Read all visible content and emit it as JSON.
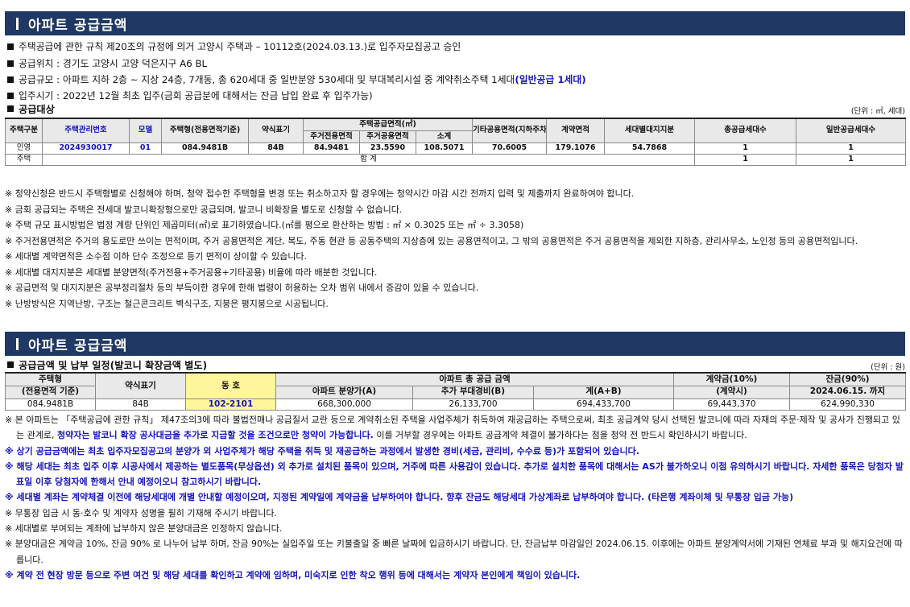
{
  "section1": {
    "title": "아파트 공급금액",
    "info": [
      "주택공급에 관한 규칙 제20조의 규정에 의거 고양시 주택과 – 10112호(2024.03.13.)로  입주자모집공고 승인",
      "공급위치 : 경기도 고양시 고양 덕은지구 A6 BL",
      "입주시기 : 2022년 12월 최초 입주(금회 공급분에 대해서는 잔금 납입 완료 후 입주가능)"
    ],
    "scale_pre": "공급규모 : 아파트 지하 2층 ~ 지상 24층, 7개동, 총 620세대 중 일반분양 530세대 및 부대복리시설 중 계약취소주택 1세대",
    "scale_blue": "(일반공급 1세대)",
    "subtitle": "공급대상",
    "unit": "(단위 : ㎡, 세대)",
    "table": {
      "h_type": "주택구분",
      "h_code": "주택관리번호",
      "h_model": "모델",
      "h_housetype": "주택형(전용면적기준)",
      "h_abbr": "약식표기",
      "h_supply_area": "주택공급면적(㎡)",
      "h_exclusive": "주거전용면적",
      "h_common": "주거공용면적",
      "h_subtotal": "소계",
      "h_other": "기타공용면적(지하주차장등)",
      "h_contract_area": "계약면적",
      "h_land": "세대별대지지분",
      "h_total_units": "총공급세대수",
      "h_general_units": "일반공급세대수",
      "row": {
        "type": "민영",
        "code": "2024930017",
        "model": "01",
        "housetype": "084.9481B",
        "abbr": "84B",
        "exclusive": "84.9481",
        "common": "23.5590",
        "subtotal": "108.5071",
        "other": "70.6005",
        "contract": "179.1076",
        "land": "54.7868",
        "total": "1",
        "general": "1"
      },
      "total_row": {
        "type": "주택",
        "label": "합 계",
        "total": "1",
        "general": "1"
      }
    },
    "notes": [
      "※ 청약신청은 반드시 주택형별로 신청해야 하며, 청약 접수한 주택형을 변경 또는 취소하고자 할 경우에는 청약시간 마감 시간 전까지 입력 및 제출까지 완료하여야 합니다.",
      "※ 금회 공급되는 주택은 전세대 발코니확장형으로만 공급되며, 발코니 비확장을 별도로 신청할 수 없습니다.",
      "※ 주택 규모 표시방법은 법정 계량 단위인 제곱미터(㎡)로 표기하였습니다.(㎡를 평으로 환산하는 방법 : ㎡ × 0.3025 또는 ㎡ ÷ 3.3058)",
      "※ 주거전용면적은 주거의 용도로만 쓰이는 면적이며, 주거 공용면적은 계단, 복도, 주동 현관 등 공동주택의 지상층에 있는 공용면적이고, 그 밖의 공용면적은 주거 공용면적을 제외한 지하층, 관리사무소, 노인정 등의 공용면적입니다.",
      "※ 세대별 계약면적은 소수점 이하 단수 조정으로 등기 면적이 상이할 수 있습니다.",
      "※ 세대별 대지지분은 세대별 분양면적(주거전용+주거공용+기타공용) 비율에 따라 배분한 것입니다.",
      "※ 공급면적 및 대지지분은 공부정리절차 등의 부득이한 경우에 한해 법령이 허용하는 오차 범위 내에서 증감이 있을 수 있습니다.",
      "※ 난방방식은 지역난방, 구조는 철근콘크리트 벽식구조, 지붕은 평지붕으로 시공됩니다."
    ]
  },
  "section2": {
    "title": "아파트 공급금액",
    "subtitle": "공급금액 및 납부 일정(발코니 확장금액 별도)",
    "unit": "(단위 : 원)",
    "table": {
      "h_housetype": "주택형",
      "h_housetype_sub": "(전용면적 기준)",
      "h_abbr": "약식표기",
      "h_unit": "동 호",
      "h_total": "아파트 총 공급 금액",
      "h_price": "아파트 분양가(A)",
      "h_extra": "추가 부대경비(B)",
      "h_sum": "계(A+B)",
      "h_deposit": "계약금(10%)",
      "h_deposit_sub": "(계약시)",
      "h_balance": "잔금(90%)",
      "h_balance_sub": "2024.06.15. 까지",
      "row": {
        "housetype": "084.9481B",
        "abbr": "84B",
        "unit": "102-2101",
        "price": "668,300,000",
        "extra": "26,133,700",
        "sum": "694,433,700",
        "deposit": "69,443,370",
        "balance": "624,990,330"
      }
    },
    "note1_pre": "※ 본 아파트는 「주택공급에 관한 규칙」 제47조의3에 따라 불법전매나 공급질서 교란 등으로 계약취소된 주택을 사업주체가 취득하여 재공급하는 주택으로써, 최초 공급계약 당시 선택된 발코니에 따라 자재의 주문·제작 및 공사가 진행되고 있는 관계로, ",
    "note1_blue": "청약자는 발코니 확장 공사대금을 추가로 지급할 것을 조건으로만 청약이 가능합니다.",
    "note1_post": " 이를 거부할 경우에는 아파트 공급계약 체결이 불가하다는 점을 청약 전 반드시 확인하시기 바랍니다.",
    "notes_blue": [
      "※ 상기 공급금액에는 최초 입주자모집공고의 분양가 외 사업주체가 해당 주택을 취득 및 재공급하는 과정에서 발생한 경비(세금, 관리비, 수수료 등)가 포함되어 있습니다.",
      "※ 해당 세대는 최초 입주 이후 시공사에서 제공하는 별도품목(무상옵션) 외 추가로 설치된 품목이 있으며, 거주에 따른 사용감이 있습니다. 추가로 설치한 품목에 대해서는 AS가 불가하오니 이점 유의하시기 바랍니다. 자세한 품목은 당첨자 발표일 이후 당첨자에 한해서 안내 예정이오니 참고하시기 바랍니다.",
      "※ 세대별 계좌는 계약체결 이전에 해당세대에 개별 안내할 예정이오며, 지정된 계약일에 계약금을 납부하여야 합니다. 향후 잔금도 해당세대 가상계좌로 납부하여야 합니다. (타은행 계좌이체 및 무통장 입금 가능)"
    ],
    "notes_plain": [
      "※ 무통장 입금 시 동·호수 및 계약자 성명을 필히 기재해 주시기 바랍니다.",
      "※ 세대별로 부여되는 계좌에 납부하지 않은 분양대금은 인정하지 않습니다.",
      "※ 분양대금은 계약금 10%, 잔금 90% 로 나누어 납부 하며, 잔금 90%는 실입주일 또는 키불출일 중 빠른 날짜에 입금하시기 바랍니다. 단, 잔금납부 마감일인 2024.06.15. 이후에는 아파트 분양계약서에 기재된 연체료 부과 및 해지요건에 따릅니다."
    ],
    "note_last": "※ 계약 전 현장 방문 등으로 주변 여건 및 해당 세대를 확인하고 계약에 임하며, 미숙지로 인한 착오 행위 등에 대해서는 계약자 본인에게 책임이 있습니다."
  }
}
